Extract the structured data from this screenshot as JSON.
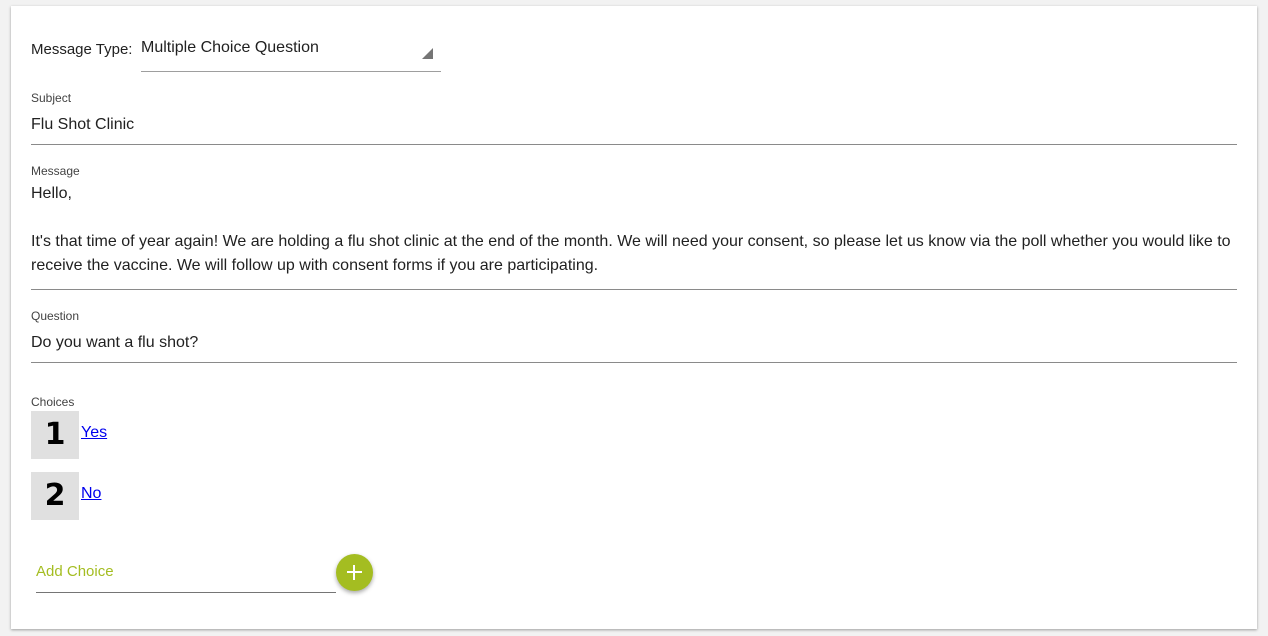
{
  "message_type": {
    "label": "Message Type:",
    "selected": "Multiple Choice Question"
  },
  "subject": {
    "label": "Subject",
    "value": "Flu Shot Clinic"
  },
  "message": {
    "label": "Message",
    "lines": [
      "Hello,",
      "",
      "It's that time of year again! We are holding a flu shot clinic at the end of the month. We will need your consent, so please let us know via the poll whether you would like to",
      "receive the vaccine. We will follow up with consent forms if you are participating."
    ]
  },
  "question": {
    "label": "Question",
    "value": "Do you want a flu shot?"
  },
  "choices": {
    "label": "Choices",
    "items": [
      {
        "number": "1",
        "text": "Yes"
      },
      {
        "number": "2",
        "text": "No"
      }
    ]
  },
  "add_choice": {
    "placeholder": "Add Choice",
    "button_icon": "plus-icon"
  },
  "colors": {
    "accent": "#a4bd21",
    "link": "#0000ee",
    "number_badge_bg": "#e0e0e0"
  }
}
